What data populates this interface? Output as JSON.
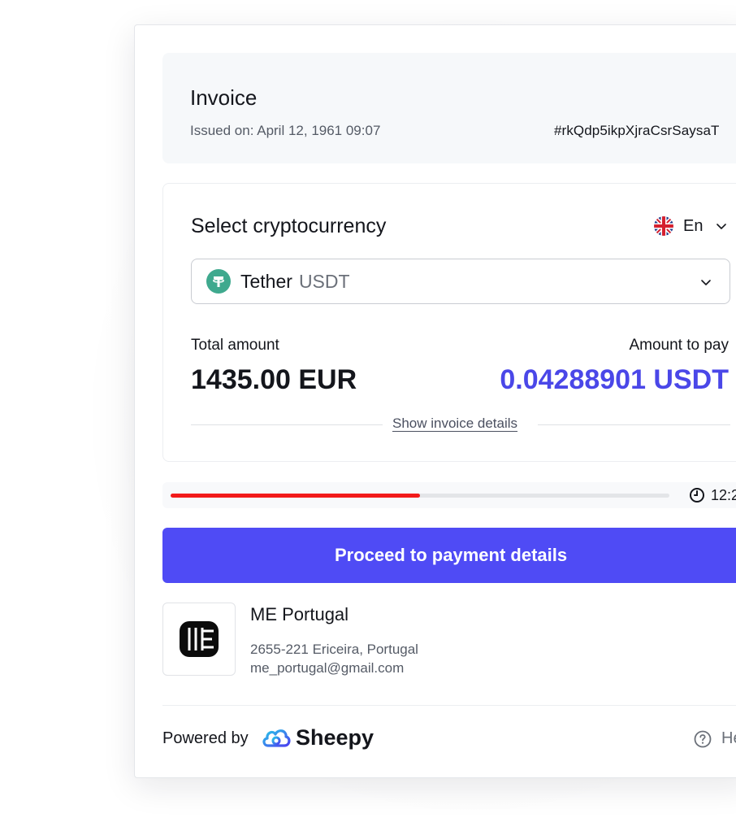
{
  "invoice": {
    "title": "Invoice",
    "issued": "Issued on: April 12, 1961 09:07",
    "id": "#rkQdp5ikpXjraCsrSaysaT"
  },
  "crypto": {
    "heading": "Select cryptocurrency",
    "language": "En",
    "selected_name": "Tether",
    "selected_code": "USDT",
    "icons": {
      "tether": "tether-icon",
      "flag": "uk-flag-icon",
      "chevron": "chevron-down-icon"
    }
  },
  "amounts": {
    "total_label": "Total amount",
    "total_value": "1435.00 EUR",
    "pay_label": "Amount to pay",
    "pay_value": "0.04288901 USDT",
    "pay_color": "#4a47e8"
  },
  "details_link": "Show invoice details",
  "timer": {
    "text": "12:2",
    "progress": 0.5,
    "bar_color": "#f21a1a"
  },
  "proceed_button": {
    "label": "Proceed to payment details",
    "color": "#4f4bf5"
  },
  "merchant": {
    "name": "ME Portugal",
    "address": "2655-221 Ericeira, Portugal",
    "email": "me_portugal@gmail.com"
  },
  "footer": {
    "powered_by": "Powered by",
    "brand": "Sheepy",
    "help": "He"
  }
}
